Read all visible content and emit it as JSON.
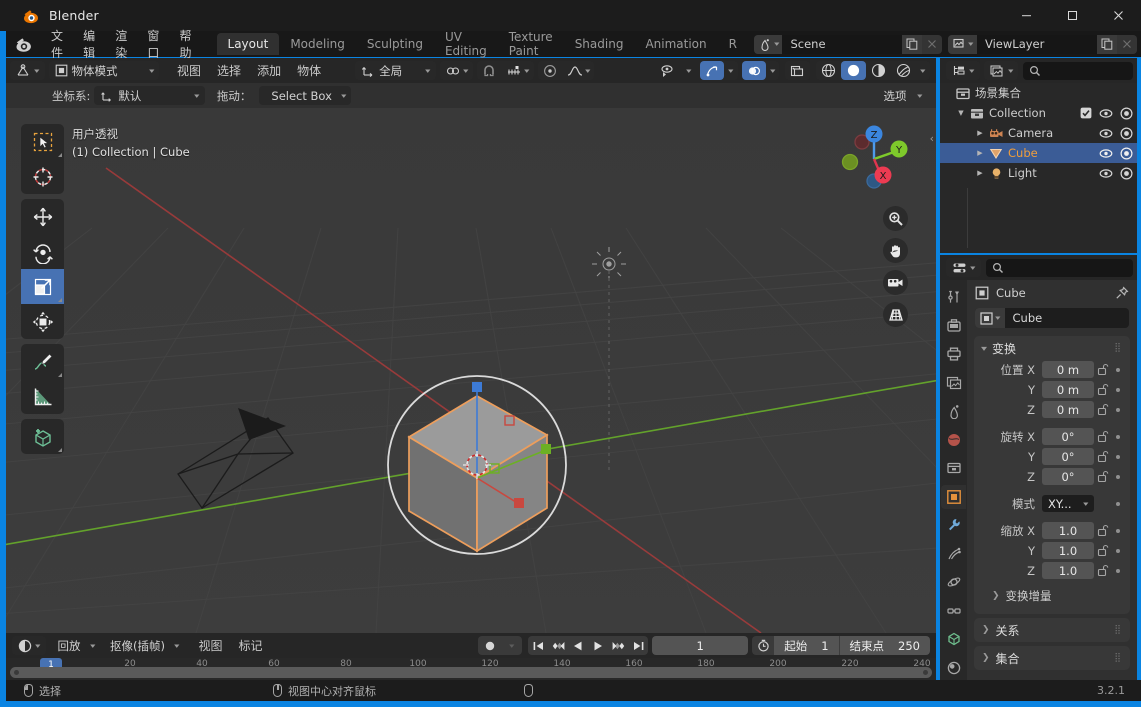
{
  "window": {
    "title": "Blender",
    "minimize": "–",
    "maximize": "□",
    "close": "✕"
  },
  "topbar": {
    "menus": [
      "文件",
      "编辑",
      "渲染",
      "窗口",
      "帮助"
    ],
    "workspace_tabs": [
      {
        "label": "Layout",
        "active": true
      },
      {
        "label": "Modeling",
        "active": false
      },
      {
        "label": "Sculpting",
        "active": false
      },
      {
        "label": "UV Editing",
        "active": false
      },
      {
        "label": "Texture Paint",
        "active": false
      },
      {
        "label": "Shading",
        "active": false
      },
      {
        "label": "Animation",
        "active": false
      },
      {
        "label": "R",
        "active": false
      }
    ],
    "scene_name": "Scene",
    "viewlayer_name": "ViewLayer"
  },
  "viewport": {
    "mode": "物体模式",
    "menus": [
      "视图",
      "选择",
      "添加",
      "物体"
    ],
    "transform_orientation": "全局",
    "orientation_label": "坐标系:",
    "orientation_value": "默认",
    "drag_label": "拖动：",
    "drag_value": "Select Box",
    "options_label": "选项",
    "overlay_line1": "用户透视",
    "overlay_line2": "(1) Collection | Cube",
    "gizmo_axes": [
      "X",
      "Y",
      "Z"
    ],
    "tools": [
      {
        "name": "tweak-tool",
        "active": false
      },
      {
        "name": "cursor-tool",
        "active": false
      },
      {
        "name": "move-tool",
        "active": false
      },
      {
        "name": "rotate-tool",
        "active": false
      },
      {
        "name": "scale-tool",
        "active": true
      },
      {
        "name": "transform-tool",
        "active": false
      },
      {
        "name": "annotate-tool",
        "active": false
      },
      {
        "name": "measure-tool",
        "active": false
      },
      {
        "name": "add-cube-tool",
        "active": false
      }
    ]
  },
  "outliner": {
    "search_placeholder": "",
    "scene_collection": "场景集合",
    "items": [
      {
        "label": "Collection",
        "type": "collection",
        "depth": 1,
        "selected": false,
        "checkbox": true,
        "eye": true,
        "camera": true,
        "expandable": true
      },
      {
        "label": "Camera",
        "type": "camera",
        "depth": 2,
        "selected": false,
        "checkbox": false,
        "eye": true,
        "camera": true,
        "expandable": true
      },
      {
        "label": "Cube",
        "type": "mesh",
        "depth": 2,
        "selected": true,
        "checkbox": false,
        "eye": true,
        "camera": true,
        "expandable": true
      },
      {
        "label": "Light",
        "type": "light",
        "depth": 2,
        "selected": false,
        "checkbox": false,
        "eye": true,
        "camera": true,
        "expandable": true
      }
    ]
  },
  "properties": {
    "breadcrumb": "Cube",
    "object_name": "Cube",
    "transform_panel": {
      "title": "变换",
      "rows": [
        {
          "label": "位置 X",
          "value": "0 m",
          "lock": true,
          "dot": true
        },
        {
          "label": "Y",
          "value": "0 m",
          "lock": true,
          "dot": true
        },
        {
          "label": "Z",
          "value": "0 m",
          "lock": true,
          "dot": true
        },
        {
          "label": "旋转 X",
          "value": "0°",
          "lock": true,
          "dot": true
        },
        {
          "label": "Y",
          "value": "0°",
          "lock": true,
          "dot": true
        },
        {
          "label": "Z",
          "value": "0°",
          "lock": true,
          "dot": true
        },
        {
          "label": "模式",
          "value": "XY...",
          "lock": false,
          "dot": true,
          "dropdown": true
        },
        {
          "label": "缩放 X",
          "value": "1.0",
          "lock": true,
          "dot": true
        },
        {
          "label": "Y",
          "value": "1.0",
          "lock": true,
          "dot": true
        },
        {
          "label": "Z",
          "value": "1.0",
          "lock": true,
          "dot": true
        }
      ],
      "subpanel": "变换增量"
    },
    "panels": [
      {
        "title": "关系"
      },
      {
        "title": "集合"
      }
    ]
  },
  "timeline": {
    "playback_label": "回放",
    "keying_label": "抠像(插帧)",
    "view_label": "视图",
    "marker_label": "标记",
    "current_frame": "1",
    "start_label": "起始",
    "start_value": "1",
    "end_label": "结束点",
    "end_value": "250",
    "playhead_frame": "1",
    "ticks": [
      "20",
      "40",
      "60",
      "80",
      "100",
      "120",
      "140",
      "160",
      "180",
      "200",
      "220",
      "240"
    ]
  },
  "statusbar": {
    "left_action": "选择",
    "middle_action": "视图中心对齐鼠标",
    "version": "3.2.1"
  },
  "colors": {
    "accent_blue": "#4772b3",
    "selection_orange": "#ed9e5c",
    "window_border": "#0a84e2",
    "axis_x": "#c44848",
    "axis_y": "#7eb627",
    "axis_z": "#3d7bd6"
  }
}
